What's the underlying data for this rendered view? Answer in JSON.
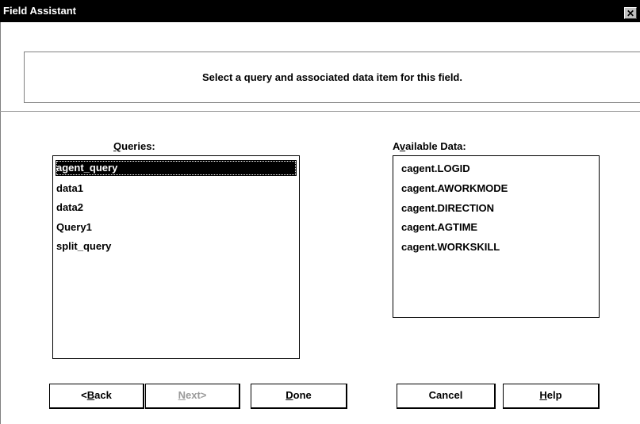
{
  "window": {
    "title": "Field Assistant",
    "close_glyph": "✕"
  },
  "instruction": "Select a query and associated data item for this field.",
  "queries": {
    "label_accel": "Q",
    "label_rest": "ueries:",
    "items": [
      "agent_query",
      "data1",
      "data2",
      "Query1",
      "split_query"
    ],
    "selected_index": 0
  },
  "available_data": {
    "label_pre": "A",
    "label_accel": "v",
    "label_rest": "ailable Data:",
    "items": [
      "cagent.LOGID",
      "cagent.AWORKMODE",
      "cagent.DIRECTION",
      "cagent.AGTIME",
      "cagent.WORKSKILL"
    ]
  },
  "buttons": {
    "back_pre": "<",
    "back_accel": "B",
    "back_rest": "ack",
    "next_accel": "N",
    "next_rest": "ext>",
    "done_accel": "D",
    "done_rest": "one",
    "cancel": "Cancel",
    "help_accel": "H",
    "help_rest": "elp"
  }
}
